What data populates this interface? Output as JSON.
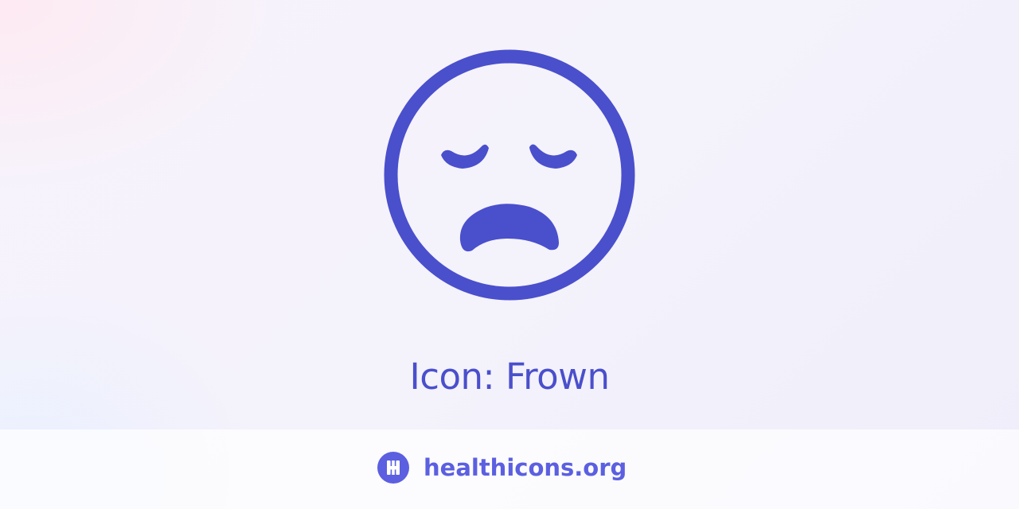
{
  "title": "Icon: Frown",
  "icon": "frown-icon",
  "footer": {
    "site": "healthicons.org",
    "logo_icon": "healthicons-logo-icon"
  },
  "colors": {
    "icon": "#4a4fcc",
    "brand": "#5b5fe0",
    "footer_bg": "#fbfbfd"
  }
}
